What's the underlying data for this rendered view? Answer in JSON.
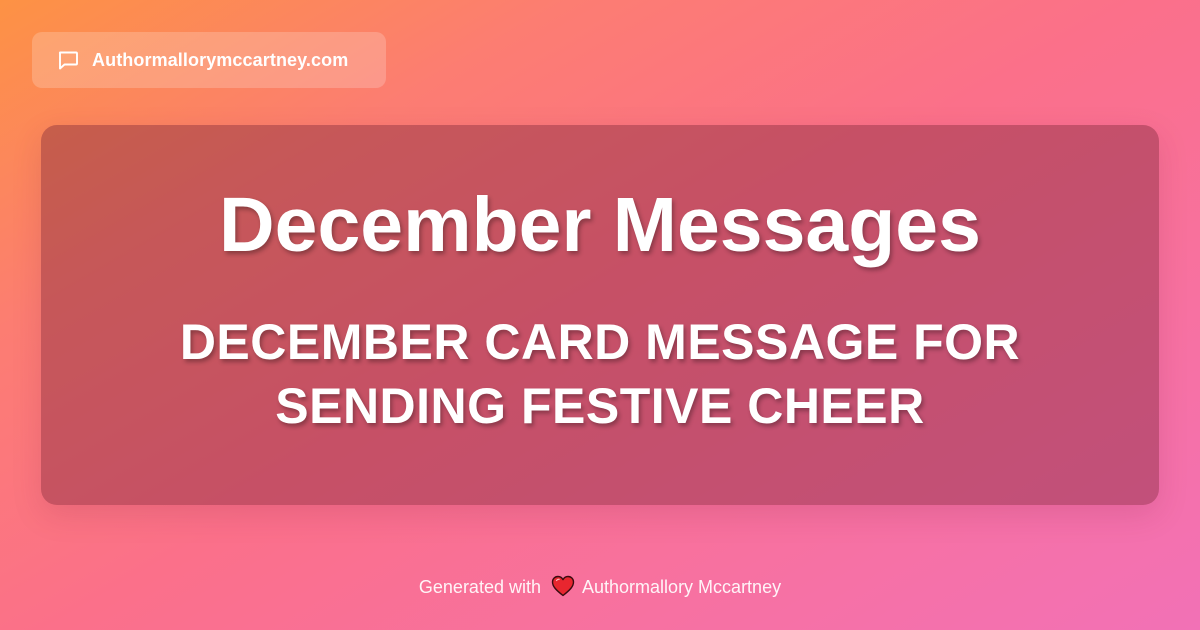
{
  "header": {
    "site_name": "Authormallorymccartney.com",
    "icon": "chat-bubble-icon"
  },
  "card": {
    "title": "December Messages",
    "subtitle": "DECEMBER CARD MESSAGE FOR SENDING FESTIVE CHEER"
  },
  "footer": {
    "prefix": "Generated with",
    "icon": "heart-icon",
    "author": "Authormallory Mccartney"
  },
  "colors": {
    "gradient_start": "#fd9244",
    "gradient_end": "#f271b6",
    "text": "#ffffff",
    "heart": "#e8262f"
  }
}
